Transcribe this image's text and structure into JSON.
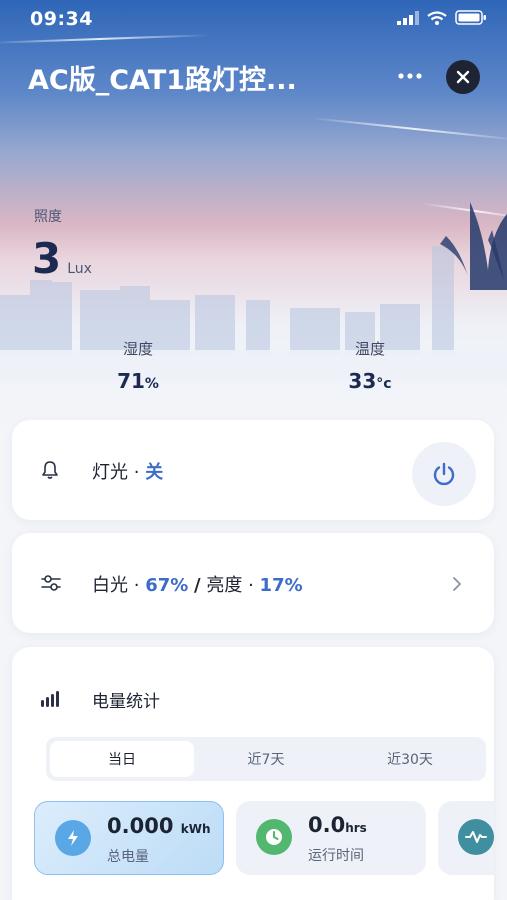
{
  "status_bar": {
    "time": "09:34"
  },
  "header": {
    "title": "AC版_CAT1路灯控..."
  },
  "illuminance": {
    "label": "照度",
    "value": "3",
    "unit": "Lux"
  },
  "humidity": {
    "label": "湿度",
    "value": "71",
    "unit": "%"
  },
  "temperature": {
    "label": "温度",
    "value": "33",
    "unit": "°c"
  },
  "light_row": {
    "label": "灯光",
    "separator": "·",
    "state": "关"
  },
  "mode_row": {
    "white_label": "白光",
    "white_value": "67%",
    "divider": "/",
    "brightness_label": "亮度",
    "brightness_value": "17%",
    "separator": "·"
  },
  "power_stats": {
    "title": "电量统计",
    "tabs": [
      {
        "label": "当日",
        "active": true
      },
      {
        "label": "近7天"
      },
      {
        "label": "近30天"
      }
    ],
    "energy": {
      "value": "0.000",
      "unit": "kWh",
      "label": "总电量"
    },
    "runtime": {
      "value": "0.0",
      "unit": "hrs",
      "label": "运行时间"
    }
  },
  "colors": {
    "accent": "#3d6cc9",
    "energy_icon": "#5aa7e6",
    "runtime_icon": "#52b86f",
    "third_icon": "#3f8fa0"
  }
}
